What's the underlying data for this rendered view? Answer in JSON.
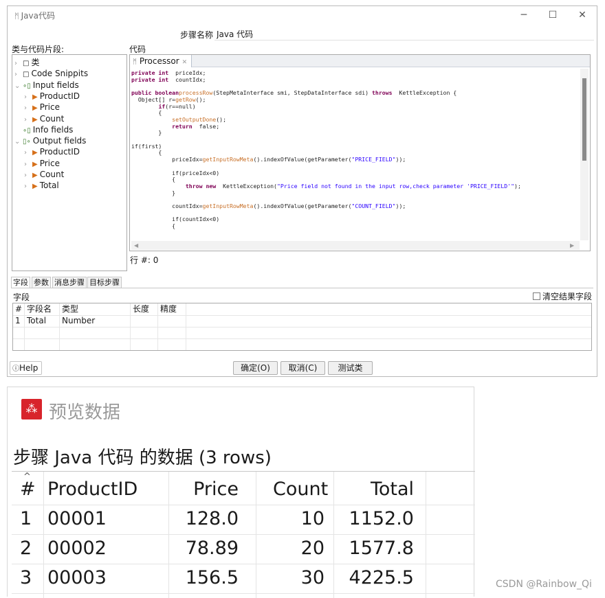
{
  "dialog": {
    "title": "Java代码",
    "step_name_label": "步骤名称",
    "step_name_value": "Java 代码",
    "tree_label": "类与代码片段:",
    "code_label": "代码",
    "tree": [
      {
        "label": "类",
        "icon": "folder-icon",
        "level": 0,
        "expander": "›"
      },
      {
        "label": "Code Snippits",
        "icon": "folder-icon",
        "level": 0,
        "expander": "›"
      },
      {
        "label": "Input fields",
        "icon": "fields-icon",
        "level": 0,
        "expander": "⌄"
      },
      {
        "label": "ProductID",
        "icon": "triangle-icon",
        "level": 1,
        "expander": "›"
      },
      {
        "label": "Price",
        "icon": "triangle-icon",
        "level": 1,
        "expander": "›"
      },
      {
        "label": "Count",
        "icon": "triangle-icon",
        "level": 1,
        "expander": "›"
      },
      {
        "label": "Info fields",
        "icon": "fields-icon",
        "level": 0,
        "expander": ""
      },
      {
        "label": "Output fields",
        "icon": "output-fields-icon",
        "level": 0,
        "expander": "⌄"
      },
      {
        "label": "ProductID",
        "icon": "triangle-icon",
        "level": 1,
        "expander": "›"
      },
      {
        "label": "Price",
        "icon": "triangle-icon",
        "level": 1,
        "expander": "›"
      },
      {
        "label": "Count",
        "icon": "triangle-icon",
        "level": 1,
        "expander": "›"
      },
      {
        "label": "Total",
        "icon": "triangle-icon",
        "level": 1,
        "expander": "›"
      }
    ],
    "editor_tab": "Processor",
    "code_lines": [
      [
        [
          "kw",
          "private int"
        ],
        [
          "",
          "  priceIdx;"
        ]
      ],
      [
        [
          "kw",
          "private int"
        ],
        [
          "",
          "  countIdx;"
        ]
      ],
      [],
      [
        [
          "kw",
          "public boolean"
        ],
        [
          "",
          ""
        ],
        [
          "fn",
          "processRow"
        ],
        [
          "",
          "(StepMetaInterface smi, StepDataInterface sdi) "
        ],
        [
          "kw",
          "throws"
        ],
        [
          "",
          "  KettleException {"
        ]
      ],
      [
        [
          "",
          "  Object[] r="
        ],
        [
          "fn",
          "getRow"
        ],
        [
          "",
          "();"
        ]
      ],
      [
        [
          "",
          "        "
        ],
        [
          "kw",
          "if"
        ],
        [
          "",
          "(r==null)"
        ]
      ],
      [
        [
          "",
          "        {"
        ]
      ],
      [
        [
          "",
          "            "
        ],
        [
          "fn",
          "setOutputDone"
        ],
        [
          "",
          "();"
        ]
      ],
      [
        [
          "",
          "            "
        ],
        [
          "kw",
          "return"
        ],
        [
          "",
          "  false;"
        ]
      ],
      [
        [
          "",
          "        }"
        ]
      ],
      [],
      [
        [
          "",
          "if(first)"
        ]
      ],
      [
        [
          "",
          "        {"
        ]
      ],
      [
        [
          "",
          "            priceIdx="
        ],
        [
          "fn",
          "getInputRowMeta"
        ],
        [
          "",
          "().indexOfValue(getParameter("
        ],
        [
          "st",
          "\"PRICE_FIELD\""
        ],
        [
          "",
          "));"
        ]
      ],
      [],
      [
        [
          "",
          "            if(priceIdx<0)"
        ]
      ],
      [
        [
          "",
          "            {"
        ]
      ],
      [
        [
          "",
          "                "
        ],
        [
          "kw",
          "throw new"
        ],
        [
          "",
          "  KettleException("
        ],
        [
          "st",
          "\"Price field not found in the input row,check parameter 'PRICE_FIELD'\""
        ],
        [
          "",
          ");"
        ]
      ],
      [
        [
          "",
          "            }"
        ]
      ],
      [],
      [
        [
          "",
          "            countIdx="
        ],
        [
          "fn",
          "getInputRowMeta"
        ],
        [
          "",
          "().indexOfValue(getParameter("
        ],
        [
          "st",
          "\"COUNT_FIELD\""
        ],
        [
          "",
          "));"
        ]
      ],
      [],
      [
        [
          "",
          "            if(countIdx<0)"
        ]
      ],
      [
        [
          "",
          "            {"
        ]
      ]
    ],
    "row_indicator": "行 #: 0",
    "lower_tabs": [
      "字段",
      "参数",
      "消息步骤",
      "目标步骤"
    ],
    "fields_label": "字段",
    "clear_results_label": "清空结果字段",
    "fields_table": {
      "headers": [
        "#",
        "字段名",
        "类型",
        "长度",
        "精度"
      ],
      "rows": [
        [
          "1",
          "Total",
          "Number",
          "",
          ""
        ]
      ]
    },
    "help_label": "Help",
    "ok_label": "确定(O)",
    "cancel_label": "取消(C)",
    "test_label": "测试类"
  },
  "preview": {
    "title": "预览数据",
    "heading": "步骤 Java 代码 的数据  (3 rows)",
    "headers": [
      "#",
      "ProductID",
      "Price",
      "Count",
      "Total"
    ],
    "rows": [
      [
        "1",
        "00001",
        "128.0",
        "10",
        "1152.0"
      ],
      [
        "2",
        "00002",
        "78.89",
        "20",
        "1577.8"
      ],
      [
        "3",
        "00003",
        "156.5",
        "30",
        "4225.5"
      ]
    ]
  },
  "watermark": "CSDN @Rainbow_Qi",
  "colors": {
    "keyword": "#7f0055",
    "method": "#c87028",
    "string": "#2a00ff",
    "brand_icon": "#d8242b"
  }
}
